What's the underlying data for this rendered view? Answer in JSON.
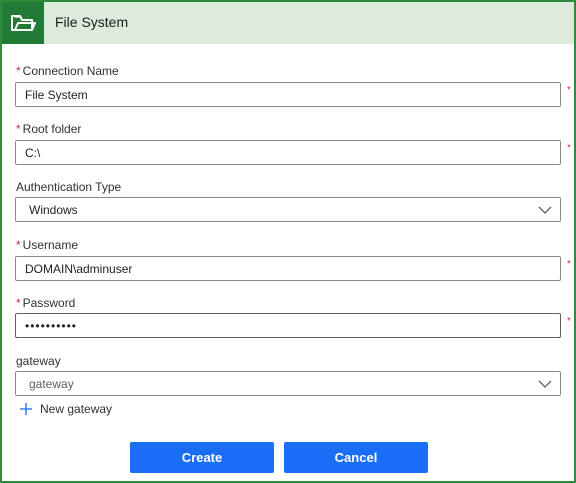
{
  "header": {
    "title": "File System",
    "icon": "folder-icon",
    "accent": "#217a35",
    "band": "#dcebdc"
  },
  "form": {
    "required_mark": "*",
    "connection_name": {
      "label": "Connection Name",
      "value": "File System"
    },
    "root_folder": {
      "label": "Root folder",
      "value": "C:\\"
    },
    "auth_type": {
      "label": "Authentication Type",
      "value": "Windows"
    },
    "username": {
      "label": "Username",
      "value": "DOMAIN\\adminuser"
    },
    "password": {
      "label": "Password",
      "value": "••••••••••"
    },
    "gateway": {
      "label": "gateway",
      "value": "gateway"
    },
    "new_gateway": "New gateway"
  },
  "buttons": {
    "create": "Create",
    "cancel": "Cancel",
    "color": "#1a6ef5"
  }
}
